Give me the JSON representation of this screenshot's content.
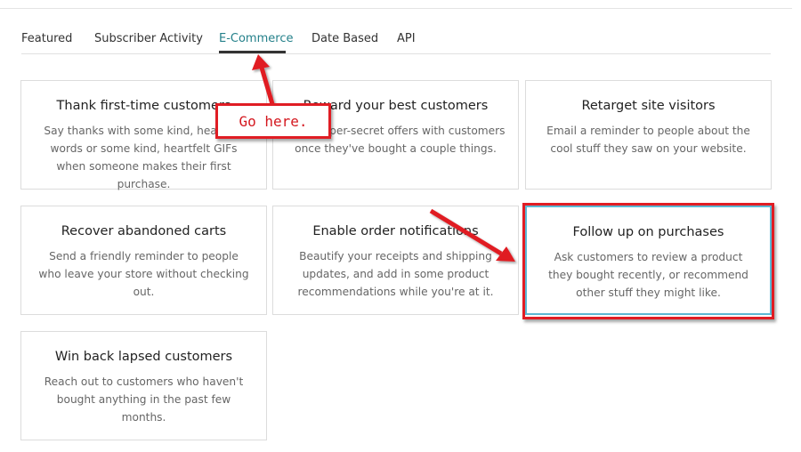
{
  "tabs": [
    {
      "label": "Featured",
      "active": false
    },
    {
      "label": "Subscriber Activity",
      "active": false
    },
    {
      "label": "E-Commerce",
      "active": true
    },
    {
      "label": "Date Based",
      "active": false
    },
    {
      "label": "API",
      "active": false
    }
  ],
  "cards": [
    {
      "title": "Thank first-time customers",
      "description": "Say thanks with some kind, heartfelt words or some kind, heartfelt GIFs when someone makes their first purchase."
    },
    {
      "title": "Reward your best customers",
      "description": "Send super-secret offers with customers once they've bought a couple things."
    },
    {
      "title": "Retarget site visitors",
      "description": "Email a reminder to people about the cool stuff they saw on your website."
    },
    {
      "title": "Recover abandoned carts",
      "description": "Send a friendly reminder to people who leave your store without checking out."
    },
    {
      "title": "Enable order notifications",
      "description": "Beautify your receipts and shipping updates, and add in some product recommendations while you're at it."
    },
    {
      "title": "Follow up on purchases",
      "description": "Ask customers to review a product they bought recently, or recommend other stuff they might like."
    },
    {
      "title": "Win back lapsed customers",
      "description": "Reach out to customers who haven't bought anything in the past few months."
    }
  ],
  "annotation": {
    "callout_text": "Go here.",
    "color": "#e01d24"
  },
  "colors": {
    "active_tab": "#24808a",
    "selected_card_border": "#5bb8d4"
  }
}
